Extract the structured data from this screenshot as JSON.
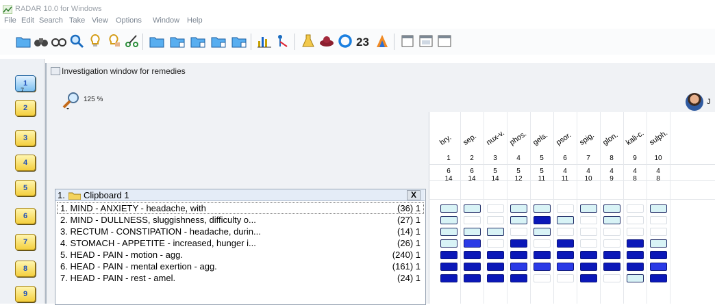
{
  "window_title": "RADAR 10.0 for Windows",
  "menu": [
    "File",
    "Edit",
    "Search",
    "Take",
    "View",
    "Options",
    "Window",
    "Help"
  ],
  "toolbar_icons": [
    "open-folder-icon",
    "binoculars-icon",
    "glasses-icon",
    "magnifier-icon",
    "bulb-icon",
    "bulb-hand-icon",
    "scissors-icon",
    "clipboard-1-icon",
    "clipboard-2-icon",
    "clipboard-3-icon",
    "clipboard-4-icon",
    "clipboard-5-icon",
    "chart-icon",
    "tree-icon",
    "flask-icon",
    "hat-icon",
    "ring-icon",
    "number-23-icon",
    "gradient-icon",
    "window-1-icon",
    "window-2-icon",
    "window-3-icon"
  ],
  "side_buttons": [
    "1",
    "2",
    "3",
    "4",
    "5",
    "6",
    "7",
    "8",
    "9"
  ],
  "side_number": "7",
  "investigation_title": "Investigation window for remedies",
  "zoom": "125 %",
  "avatar_initial": "J",
  "clipboard": {
    "title": "1.",
    "name": "Clipboard 1",
    "close": "X"
  },
  "rubrics": [
    {
      "text": "1. MIND - ANXIETY - headache, with",
      "count": "(36) 1"
    },
    {
      "text": "2. MIND - DULLNESS, sluggishness, difficulty o...",
      "count": "(27) 1"
    },
    {
      "text": "3. RECTUM - CONSTIPATION - headache, durin...",
      "count": "(14) 1"
    },
    {
      "text": "4. STOMACH - APPETITE - increased, hunger i...",
      "count": "(26) 1"
    },
    {
      "text": "5. HEAD - PAIN - motion - agg.",
      "count": "(240) 1"
    },
    {
      "text": "6. HEAD - PAIN - mental exertion - agg.",
      "count": "(161) 1"
    },
    {
      "text": "7. HEAD - PAIN - rest - amel.",
      "count": "(24) 1"
    }
  ],
  "remedies": [
    {
      "abbr": "bry.",
      "num": "1",
      "sum": "6",
      "count": "14",
      "grades": [
        1,
        1,
        1,
        1,
        3,
        3,
        3
      ]
    },
    {
      "abbr": "sep.",
      "num": "2",
      "sum": "6",
      "count": "14",
      "grades": [
        1,
        0,
        1,
        2,
        3,
        3,
        3
      ]
    },
    {
      "abbr": "nux-v.",
      "num": "3",
      "sum": "5",
      "count": "14",
      "grades": [
        0,
        0,
        1,
        0,
        3,
        3,
        3
      ]
    },
    {
      "abbr": "phos.",
      "num": "4",
      "sum": "5",
      "count": "12",
      "grades": [
        1,
        1,
        0,
        3,
        3,
        2,
        3
      ]
    },
    {
      "abbr": "gels.",
      "num": "5",
      "sum": "5",
      "count": "11",
      "grades": [
        1,
        3,
        1,
        0,
        3,
        2,
        0
      ]
    },
    {
      "abbr": "psor.",
      "num": "6",
      "sum": "4",
      "count": "11",
      "grades": [
        0,
        1,
        0,
        3,
        3,
        2,
        0
      ]
    },
    {
      "abbr": "spig.",
      "num": "7",
      "sum": "4",
      "count": "10",
      "grades": [
        1,
        0,
        0,
        0,
        3,
        3,
        3
      ]
    },
    {
      "abbr": "glon.",
      "num": "8",
      "sum": "4",
      "count": "9",
      "grades": [
        1,
        1,
        0,
        0,
        3,
        3,
        0
      ]
    },
    {
      "abbr": "kali-c.",
      "num": "9",
      "sum": "4",
      "count": "8",
      "grades": [
        0,
        0,
        0,
        3,
        3,
        3,
        1
      ]
    },
    {
      "abbr": "sulph.",
      "num": "10",
      "sum": "4",
      "count": "8",
      "grades": [
        1,
        0,
        0,
        1,
        3,
        2,
        3
      ]
    }
  ],
  "grade_colors": {
    "0": "#ffffff",
    "1": "#d8f3f6",
    "2": "#2a3ae6",
    "3": "#0b18b8"
  }
}
